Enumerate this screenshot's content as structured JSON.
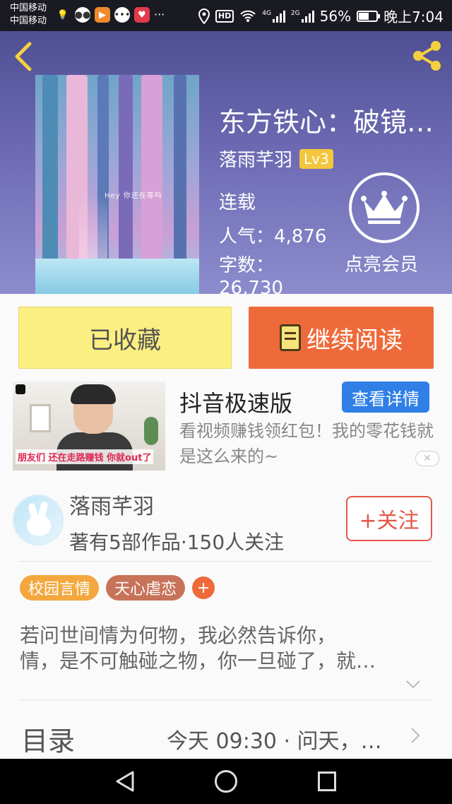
{
  "status_bar": {
    "carrier_1": "中国移动",
    "carrier_2": "中国移动",
    "app_icons": [
      "bulb-icon",
      "wechat-icon",
      "video-icon",
      "chat-icon",
      "heart-icon"
    ],
    "more": "···",
    "hd": "HD",
    "net_4g": "4G",
    "net_2g": "2G",
    "battery": "56%",
    "battery_level": 0.56,
    "time": "晚上7:04"
  },
  "header": {
    "book_title": "东方铁心：破镜…",
    "author": "落雨芊羽",
    "level": "Lv3",
    "status": "连载",
    "popularity_label": "人气：",
    "popularity_value": "4,876",
    "words_label": "字数：",
    "words_value": "26,730",
    "vip_label": "点亮会员",
    "cover_text": "Hey 你还在等吗"
  },
  "actions": {
    "collected_label": "已收藏",
    "continue_label": "继续阅读"
  },
  "ad": {
    "caption": "朋友们 还在走路赚钱 你就out了",
    "title": "抖音极速版",
    "detail_button": "查看详情",
    "description": "看视频赚钱领红包！我的零花钱就是这么来的~",
    "close": "✕"
  },
  "author_section": {
    "name": "落雨芊羽",
    "stats": "著有5部作品·150人关注",
    "follow_label": "+关注"
  },
  "tags": [
    "校园言情",
    "天心虐恋"
  ],
  "tag_add": "+",
  "synopsis": {
    "line1": "若问世间情为何物，我必然告诉你，",
    "line2": "情，是不可触碰之物，你一旦碰了，就…"
  },
  "toc": {
    "label": "目录",
    "latest": "今天 09:30 · 问天，…"
  },
  "colors": {
    "header_bg": "#6d6ab3",
    "collected_bg": "#fbef82",
    "read_bg": "#ef6a3a",
    "follow": "#e2584a",
    "tag1": "#f3a83f",
    "tag2": "#c7735a",
    "level_badge": "#f4c63d",
    "ad_button": "#2f7fe6"
  }
}
